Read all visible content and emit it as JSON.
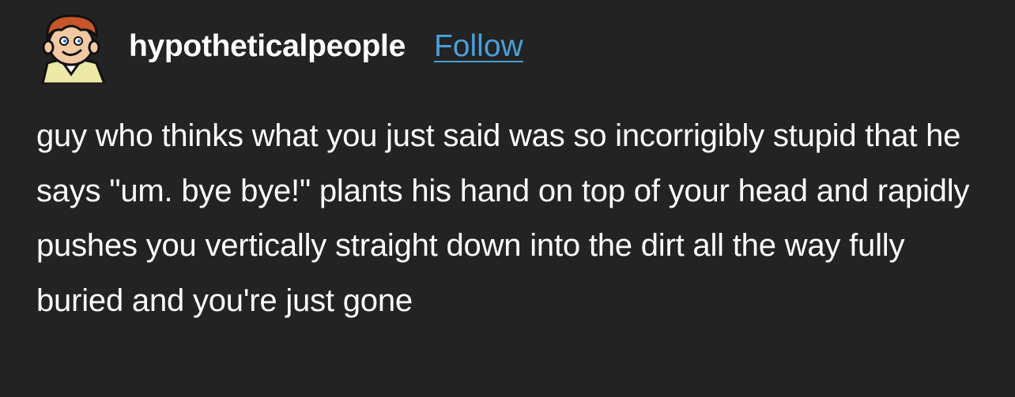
{
  "post": {
    "author": {
      "username": "hypotheticalpeople",
      "avatar_icon": "cartoon-boy-avatar-icon"
    },
    "follow_label": "Follow",
    "body_text": "guy who thinks what you just said was so incorrigibly stupid that he says \"um. bye bye!\" plants his hand on top of your head and rapidly pushes you vertically straight down into the dirt all the way fully buried and you're just gone"
  },
  "colors": {
    "background": "#232323",
    "text": "#ffffff",
    "link": "#4a9fd9"
  }
}
